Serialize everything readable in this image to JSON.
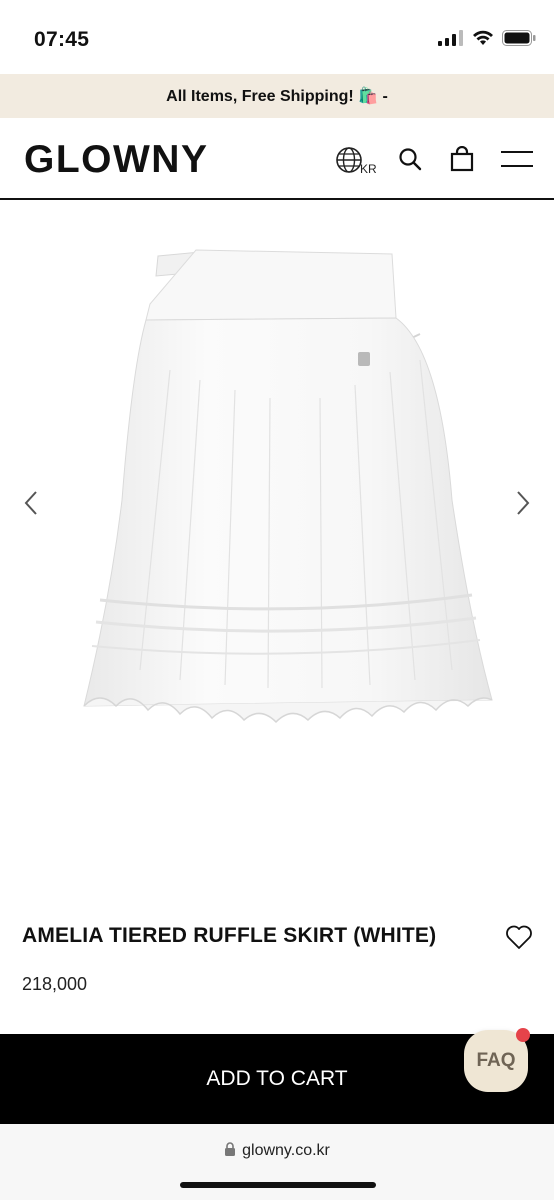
{
  "status_bar": {
    "time": "07:45"
  },
  "promo": {
    "text": "All Items, Free Shipping! 🛍️ -"
  },
  "header": {
    "logo": "GLOWNY",
    "language": "KR"
  },
  "product": {
    "title": "AMELIA TIERED RUFFLE SKIRT (WHITE)",
    "price": "218,000"
  },
  "actions": {
    "add_to_cart": "ADD TO CART",
    "faq": "FAQ"
  },
  "browser": {
    "url": "glowny.co.kr"
  },
  "icons": {
    "language": "globe-icon",
    "search": "search-icon",
    "cart": "shopping-bag-icon",
    "menu": "hamburger-menu-icon",
    "prev": "chevron-left-icon",
    "next": "chevron-right-icon",
    "wishlist": "heart-icon",
    "lock": "lock-icon"
  }
}
